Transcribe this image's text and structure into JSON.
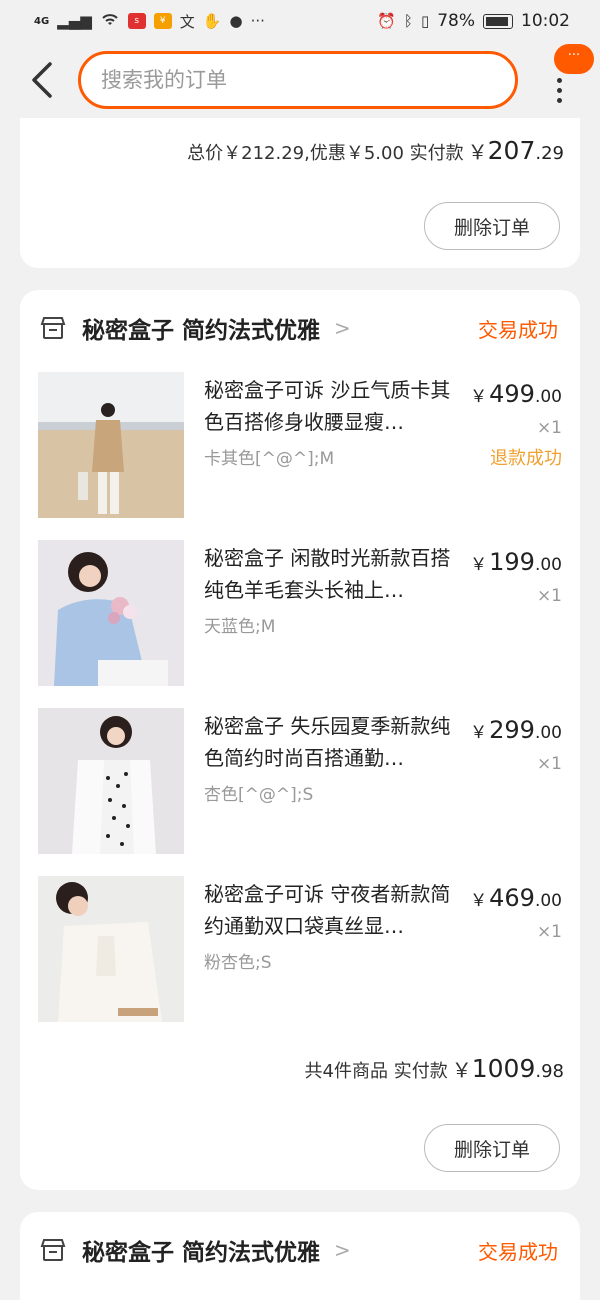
{
  "status_bar": {
    "time": "10:02",
    "battery": "78%",
    "network": "4G"
  },
  "search": {
    "placeholder": "搜索我的订单"
  },
  "msg_badge": "···",
  "prev_order": {
    "summary_label": "总价￥212.29,优惠￥5.00 实付款",
    "currency": "￥",
    "paid_int": "207",
    "paid_dec": ".29",
    "delete_label": "删除订单"
  },
  "order": {
    "shop_name": "秘密盒子 简约法式优雅",
    "status": "交易成功",
    "items": [
      {
        "title": "秘密盒子可诉 沙丘气质卡其色百搭修身收腰显瘦…",
        "sku": "卡其色[^@^];M",
        "currency": "￥",
        "price_int": "499",
        "price_dec": ".00",
        "qty": "×1",
        "refund": "退款成功"
      },
      {
        "title": "秘密盒子 闲散时光新款百搭纯色羊毛套头长袖上…",
        "sku": "天蓝色;M",
        "currency": "￥",
        "price_int": "199",
        "price_dec": ".00",
        "qty": "×1"
      },
      {
        "title": "秘密盒子 失乐园夏季新款纯色简约时尚百搭通勤…",
        "sku": "杏色[^@^];S",
        "currency": "￥",
        "price_int": "299",
        "price_dec": ".00",
        "qty": "×1"
      },
      {
        "title": "秘密盒子可诉 守夜者新款简约通勤双口袋真丝显…",
        "sku": "粉杏色;S",
        "currency": "￥",
        "price_int": "469",
        "price_dec": ".00",
        "qty": "×1"
      }
    ],
    "summary_label": "共4件商品 实付款",
    "currency": "￥",
    "paid_int": "1009",
    "paid_dec": ".98",
    "delete_label": "删除订单"
  },
  "next_order": {
    "shop_name": "秘密盒子 简约法式优雅",
    "status": "交易成功"
  },
  "colors": {
    "accent": "#ff5a00",
    "refund": "#f0a030",
    "background": "#f1f1f1"
  }
}
